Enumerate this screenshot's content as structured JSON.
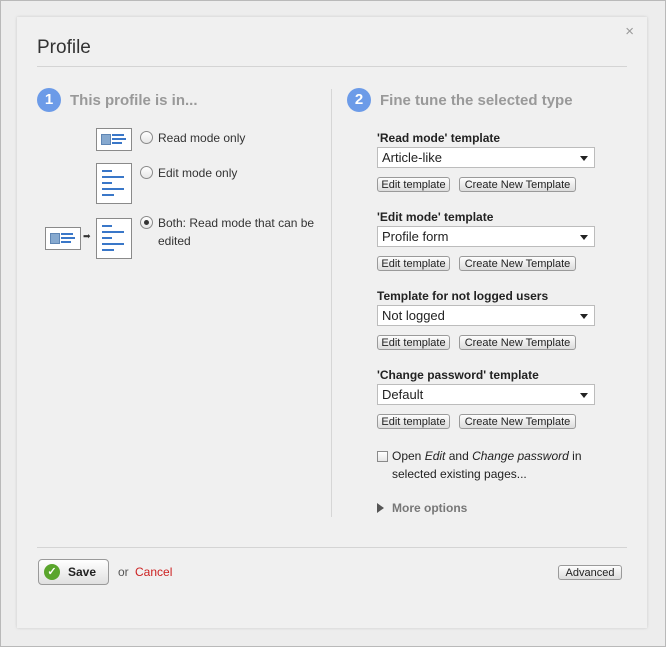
{
  "dialog": {
    "title": "Profile",
    "close_glyph": "×"
  },
  "step1": {
    "number": "1",
    "title": "This profile is in..."
  },
  "step2": {
    "number": "2",
    "title": "Fine tune the selected type"
  },
  "mode_options": [
    {
      "label": "Read mode only",
      "selected": false
    },
    {
      "label": "Edit mode only",
      "selected": false
    },
    {
      "label_line1": "Both: Read mode that can be",
      "label_line2": "edited",
      "selected": true
    }
  ],
  "templates": [
    {
      "label": "'Read mode' template",
      "value": "Article-like",
      "edit_label": "Edit template",
      "new_label": "Create New Template"
    },
    {
      "label": "'Edit mode' template",
      "value": "Profile form",
      "edit_label": "Edit template",
      "new_label": "Create New Template"
    },
    {
      "label": "Template for not logged users",
      "value": "Not logged",
      "edit_label": "Edit template",
      "new_label": "Create New Template"
    },
    {
      "label": "'Change password' template",
      "value": "Default",
      "edit_label": "Edit template",
      "new_label": "Create New Template"
    }
  ],
  "open_option": {
    "checked": false,
    "part1": "Open ",
    "em1": "Edit",
    "part2": " and ",
    "em2": "Change password",
    "part3": " in",
    "line2": "selected existing pages..."
  },
  "more_options": "More options",
  "footer": {
    "save_label": "Save",
    "or_text": "or",
    "cancel_label": "Cancel",
    "advanced_label": "Advanced"
  },
  "icons": {
    "save": "check-icon",
    "close": "close-icon",
    "more": "triangle-right-icon"
  },
  "colors": {
    "step_badge": "#6c9be8",
    "cancel": "#cc2222",
    "save_icon": "#5aa52c"
  }
}
